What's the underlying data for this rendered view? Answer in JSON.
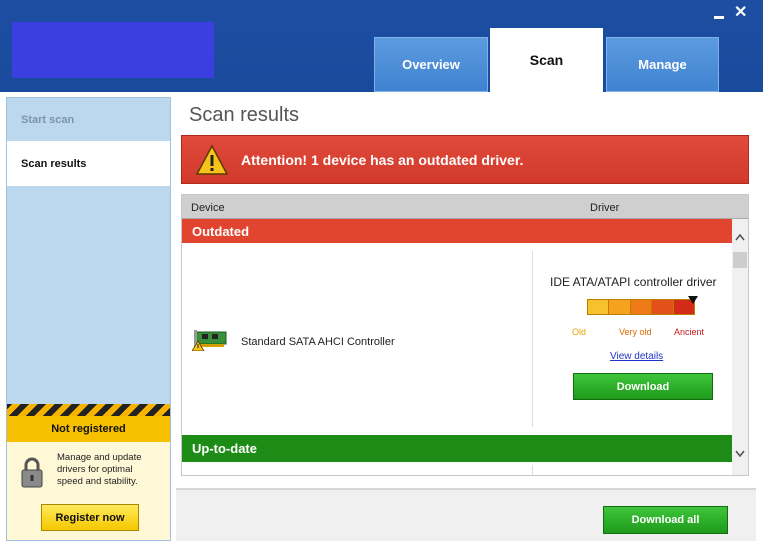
{
  "window": {
    "minimize_label": "",
    "close_label": "✕"
  },
  "tabs": [
    {
      "label": "Overview"
    },
    {
      "label": "Scan"
    },
    {
      "label": "Manage"
    }
  ],
  "sidebar": {
    "items": [
      {
        "label": "Start scan"
      },
      {
        "label": "Scan results"
      }
    ],
    "status": "Not registered",
    "description": "Manage and update drivers for optimal speed and stability.",
    "register_label": "Register now"
  },
  "main": {
    "title": "Scan results",
    "alert": "Attention! 1 device has an outdated driver.",
    "table": {
      "columns": [
        "Device",
        "Driver"
      ],
      "groups": [
        {
          "label": "Outdated",
          "rows": [
            {
              "device": "Standard SATA AHCI Controller",
              "driver": "IDE ATA/ATAPI controller driver",
              "age_levels": [
                "Old",
                "Very old",
                "Ancient"
              ],
              "age_value": "Ancient",
              "view_details_label": "View details",
              "download_label": "Download"
            }
          ]
        },
        {
          "label": "Up-to-date",
          "rows": []
        }
      ]
    }
  },
  "footer": {
    "download_all_label": "Download all"
  },
  "colors": {
    "titlebar": "#1a4a9c",
    "tab": "#3f82d0",
    "alert": "#d23a2c",
    "outdated": "#e2452f",
    "uptodate": "#1d8c16",
    "button_green": "#1f9a1c",
    "register_yellow": "#f5c800"
  },
  "icons": {
    "warning": "warning-icon",
    "device": "pci-card-warning-icon",
    "lock": "lock-icon",
    "scroll_up": "chevron-up-icon",
    "scroll_down": "chevron-down-icon"
  }
}
